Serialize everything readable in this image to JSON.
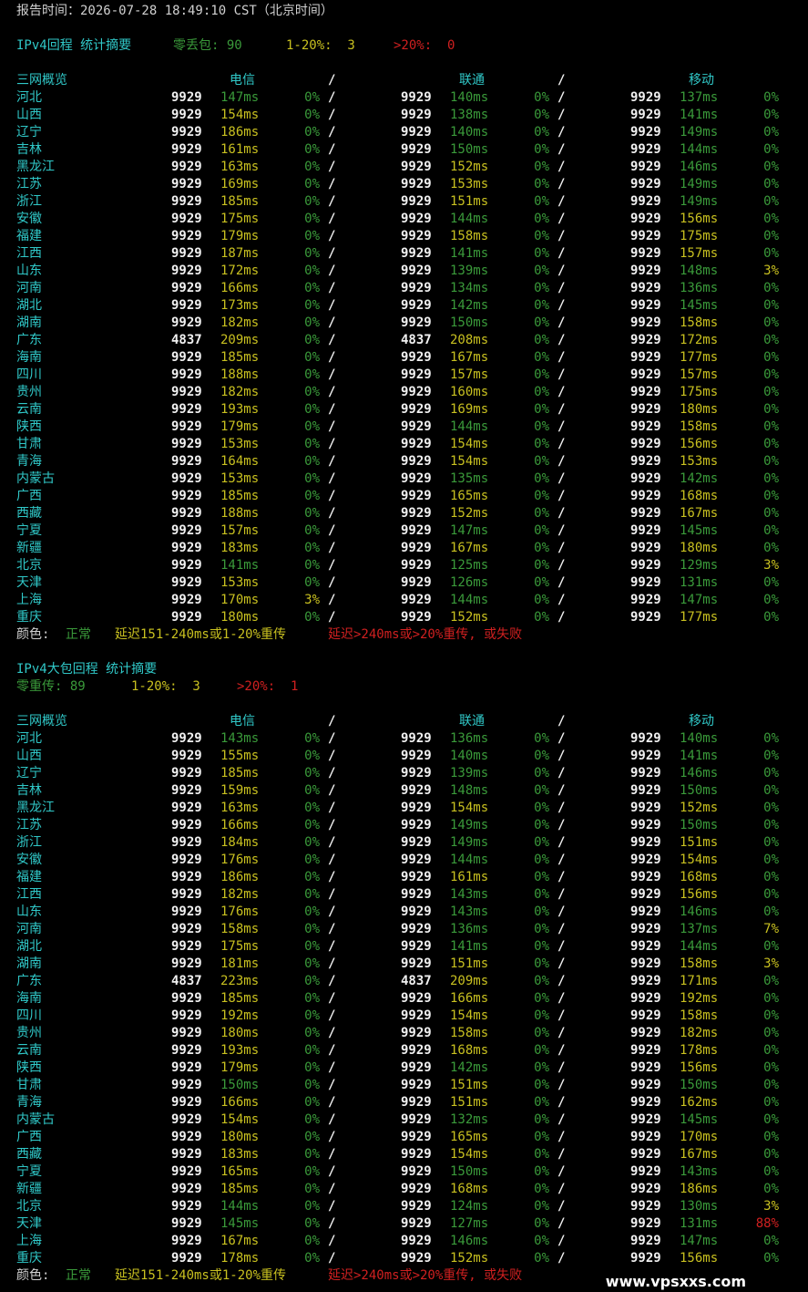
{
  "header": {
    "report_time": "报告时间：2026-07-28 18:49:10 CST（北京时间）"
  },
  "colors": {
    "cyan": "#30c8c8",
    "green": "#3a9a3a",
    "yellow": "#c8c020",
    "red": "#d02020",
    "white": "#d0d0d0"
  },
  "sections": [
    {
      "id": "ipv4",
      "summary": [
        {
          "t": "IPv4回程 统计摘要",
          "c": "cyan"
        },
        {
          "t": "零丢包: 90",
          "c": "green"
        },
        {
          "t": "1-20%:  3",
          "c": "yellow"
        },
        {
          "t": ">20%:  0",
          "c": "red"
        }
      ],
      "summary_wrap": false,
      "columns": {
        "region": "三网概览",
        "dx": "电信",
        "lt": "联通",
        "yd": "移动",
        "sep": "/"
      },
      "rows": [
        [
          "河北",
          "9929",
          "147ms",
          "0%",
          "9929",
          "140ms",
          "0%",
          "9929",
          "137ms",
          "0%"
        ],
        [
          "山西",
          "9929",
          "154ms",
          "0%",
          "9929",
          "138ms",
          "0%",
          "9929",
          "141ms",
          "0%"
        ],
        [
          "辽宁",
          "9929",
          "186ms",
          "0%",
          "9929",
          "140ms",
          "0%",
          "9929",
          "149ms",
          "0%"
        ],
        [
          "吉林",
          "9929",
          "161ms",
          "0%",
          "9929",
          "150ms",
          "0%",
          "9929",
          "144ms",
          "0%"
        ],
        [
          "黑龙江",
          "9929",
          "163ms",
          "0%",
          "9929",
          "152ms",
          "0%",
          "9929",
          "146ms",
          "0%"
        ],
        [
          "江苏",
          "9929",
          "169ms",
          "0%",
          "9929",
          "153ms",
          "0%",
          "9929",
          "149ms",
          "0%"
        ],
        [
          "浙江",
          "9929",
          "185ms",
          "0%",
          "9929",
          "151ms",
          "0%",
          "9929",
          "149ms",
          "0%"
        ],
        [
          "安徽",
          "9929",
          "175ms",
          "0%",
          "9929",
          "144ms",
          "0%",
          "9929",
          "156ms",
          "0%"
        ],
        [
          "福建",
          "9929",
          "179ms",
          "0%",
          "9929",
          "158ms",
          "0%",
          "9929",
          "175ms",
          "0%"
        ],
        [
          "江西",
          "9929",
          "187ms",
          "0%",
          "9929",
          "141ms",
          "0%",
          "9929",
          "157ms",
          "0%"
        ],
        [
          "山东",
          "9929",
          "172ms",
          "0%",
          "9929",
          "139ms",
          "0%",
          "9929",
          "148ms",
          "3%"
        ],
        [
          "河南",
          "9929",
          "166ms",
          "0%",
          "9929",
          "134ms",
          "0%",
          "9929",
          "136ms",
          "0%"
        ],
        [
          "湖北",
          "9929",
          "173ms",
          "0%",
          "9929",
          "142ms",
          "0%",
          "9929",
          "145ms",
          "0%"
        ],
        [
          "湖南",
          "9929",
          "182ms",
          "0%",
          "9929",
          "150ms",
          "0%",
          "9929",
          "158ms",
          "0%"
        ],
        [
          "广东",
          "4837",
          "209ms",
          "0%",
          "4837",
          "208ms",
          "0%",
          "9929",
          "172ms",
          "0%"
        ],
        [
          "海南",
          "9929",
          "185ms",
          "0%",
          "9929",
          "167ms",
          "0%",
          "9929",
          "177ms",
          "0%"
        ],
        [
          "四川",
          "9929",
          "188ms",
          "0%",
          "9929",
          "157ms",
          "0%",
          "9929",
          "157ms",
          "0%"
        ],
        [
          "贵州",
          "9929",
          "182ms",
          "0%",
          "9929",
          "160ms",
          "0%",
          "9929",
          "175ms",
          "0%"
        ],
        [
          "云南",
          "9929",
          "193ms",
          "0%",
          "9929",
          "169ms",
          "0%",
          "9929",
          "180ms",
          "0%"
        ],
        [
          "陕西",
          "9929",
          "179ms",
          "0%",
          "9929",
          "144ms",
          "0%",
          "9929",
          "158ms",
          "0%"
        ],
        [
          "甘肃",
          "9929",
          "153ms",
          "0%",
          "9929",
          "154ms",
          "0%",
          "9929",
          "156ms",
          "0%"
        ],
        [
          "青海",
          "9929",
          "164ms",
          "0%",
          "9929",
          "154ms",
          "0%",
          "9929",
          "153ms",
          "0%"
        ],
        [
          "内蒙古",
          "9929",
          "153ms",
          "0%",
          "9929",
          "135ms",
          "0%",
          "9929",
          "142ms",
          "0%"
        ],
        [
          "广西",
          "9929",
          "185ms",
          "0%",
          "9929",
          "165ms",
          "0%",
          "9929",
          "168ms",
          "0%"
        ],
        [
          "西藏",
          "9929",
          "188ms",
          "0%",
          "9929",
          "152ms",
          "0%",
          "9929",
          "167ms",
          "0%"
        ],
        [
          "宁夏",
          "9929",
          "157ms",
          "0%",
          "9929",
          "147ms",
          "0%",
          "9929",
          "145ms",
          "0%"
        ],
        [
          "新疆",
          "9929",
          "183ms",
          "0%",
          "9929",
          "167ms",
          "0%",
          "9929",
          "180ms",
          "0%"
        ],
        [
          "北京",
          "9929",
          "141ms",
          "0%",
          "9929",
          "125ms",
          "0%",
          "9929",
          "129ms",
          "3%"
        ],
        [
          "天津",
          "9929",
          "153ms",
          "0%",
          "9929",
          "126ms",
          "0%",
          "9929",
          "131ms",
          "0%"
        ],
        [
          "上海",
          "9929",
          "170ms",
          "3%",
          "9929",
          "144ms",
          "0%",
          "9929",
          "147ms",
          "0%"
        ],
        [
          "重庆",
          "9929",
          "180ms",
          "0%",
          "9929",
          "152ms",
          "0%",
          "9929",
          "177ms",
          "0%"
        ]
      ],
      "legend": [
        {
          "t": "颜色:",
          "c": "white"
        },
        {
          "t": "正常",
          "c": "green"
        },
        {
          "t": "延迟151-240ms或1-20%重传",
          "c": "yellow"
        },
        {
          "t": "延迟>240ms或>20%重传, 或失败",
          "c": "red"
        }
      ]
    },
    {
      "id": "ipv4-large",
      "summary": [
        {
          "t": "IPv4大包回程 统计摘要",
          "c": "cyan"
        },
        {
          "t": "零重传: 89",
          "c": "green"
        },
        {
          "t": "1-20%:  3",
          "c": "yellow"
        },
        {
          "t": ">20%:  1",
          "c": "red"
        }
      ],
      "summary_wrap": true,
      "columns": {
        "region": "三网概览",
        "dx": "电信",
        "lt": "联通",
        "yd": "移动",
        "sep": "/"
      },
      "rows": [
        [
          "河北",
          "9929",
          "143ms",
          "0%",
          "9929",
          "136ms",
          "0%",
          "9929",
          "140ms",
          "0%"
        ],
        [
          "山西",
          "9929",
          "155ms",
          "0%",
          "9929",
          "140ms",
          "0%",
          "9929",
          "141ms",
          "0%"
        ],
        [
          "辽宁",
          "9929",
          "185ms",
          "0%",
          "9929",
          "139ms",
          "0%",
          "9929",
          "146ms",
          "0%"
        ],
        [
          "吉林",
          "9929",
          "159ms",
          "0%",
          "9929",
          "148ms",
          "0%",
          "9929",
          "150ms",
          "0%"
        ],
        [
          "黑龙江",
          "9929",
          "163ms",
          "0%",
          "9929",
          "154ms",
          "0%",
          "9929",
          "152ms",
          "0%"
        ],
        [
          "江苏",
          "9929",
          "166ms",
          "0%",
          "9929",
          "149ms",
          "0%",
          "9929",
          "150ms",
          "0%"
        ],
        [
          "浙江",
          "9929",
          "184ms",
          "0%",
          "9929",
          "149ms",
          "0%",
          "9929",
          "151ms",
          "0%"
        ],
        [
          "安徽",
          "9929",
          "176ms",
          "0%",
          "9929",
          "144ms",
          "0%",
          "9929",
          "154ms",
          "0%"
        ],
        [
          "福建",
          "9929",
          "186ms",
          "0%",
          "9929",
          "161ms",
          "0%",
          "9929",
          "168ms",
          "0%"
        ],
        [
          "江西",
          "9929",
          "182ms",
          "0%",
          "9929",
          "143ms",
          "0%",
          "9929",
          "156ms",
          "0%"
        ],
        [
          "山东",
          "9929",
          "176ms",
          "0%",
          "9929",
          "143ms",
          "0%",
          "9929",
          "146ms",
          "0%"
        ],
        [
          "河南",
          "9929",
          "158ms",
          "0%",
          "9929",
          "136ms",
          "0%",
          "9929",
          "137ms",
          "7%"
        ],
        [
          "湖北",
          "9929",
          "175ms",
          "0%",
          "9929",
          "141ms",
          "0%",
          "9929",
          "144ms",
          "0%"
        ],
        [
          "湖南",
          "9929",
          "181ms",
          "0%",
          "9929",
          "151ms",
          "0%",
          "9929",
          "158ms",
          "3%"
        ],
        [
          "广东",
          "4837",
          "223ms",
          "0%",
          "4837",
          "209ms",
          "0%",
          "9929",
          "171ms",
          "0%"
        ],
        [
          "海南",
          "9929",
          "185ms",
          "0%",
          "9929",
          "166ms",
          "0%",
          "9929",
          "192ms",
          "0%"
        ],
        [
          "四川",
          "9929",
          "192ms",
          "0%",
          "9929",
          "154ms",
          "0%",
          "9929",
          "158ms",
          "0%"
        ],
        [
          "贵州",
          "9929",
          "180ms",
          "0%",
          "9929",
          "158ms",
          "0%",
          "9929",
          "182ms",
          "0%"
        ],
        [
          "云南",
          "9929",
          "193ms",
          "0%",
          "9929",
          "168ms",
          "0%",
          "9929",
          "178ms",
          "0%"
        ],
        [
          "陕西",
          "9929",
          "179ms",
          "0%",
          "9929",
          "142ms",
          "0%",
          "9929",
          "156ms",
          "0%"
        ],
        [
          "甘肃",
          "9929",
          "150ms",
          "0%",
          "9929",
          "151ms",
          "0%",
          "9929",
          "150ms",
          "0%"
        ],
        [
          "青海",
          "9929",
          "166ms",
          "0%",
          "9929",
          "151ms",
          "0%",
          "9929",
          "162ms",
          "0%"
        ],
        [
          "内蒙古",
          "9929",
          "154ms",
          "0%",
          "9929",
          "132ms",
          "0%",
          "9929",
          "145ms",
          "0%"
        ],
        [
          "广西",
          "9929",
          "180ms",
          "0%",
          "9929",
          "165ms",
          "0%",
          "9929",
          "170ms",
          "0%"
        ],
        [
          "西藏",
          "9929",
          "183ms",
          "0%",
          "9929",
          "154ms",
          "0%",
          "9929",
          "167ms",
          "0%"
        ],
        [
          "宁夏",
          "9929",
          "165ms",
          "0%",
          "9929",
          "150ms",
          "0%",
          "9929",
          "143ms",
          "0%"
        ],
        [
          "新疆",
          "9929",
          "185ms",
          "0%",
          "9929",
          "168ms",
          "0%",
          "9929",
          "186ms",
          "0%"
        ],
        [
          "北京",
          "9929",
          "144ms",
          "0%",
          "9929",
          "124ms",
          "0%",
          "9929",
          "130ms",
          "3%"
        ],
        [
          "天津",
          "9929",
          "145ms",
          "0%",
          "9929",
          "127ms",
          "0%",
          "9929",
          "131ms",
          "88%"
        ],
        [
          "上海",
          "9929",
          "167ms",
          "0%",
          "9929",
          "146ms",
          "0%",
          "9929",
          "147ms",
          "0%"
        ],
        [
          "重庆",
          "9929",
          "178ms",
          "0%",
          "9929",
          "152ms",
          "0%",
          "9929",
          "156ms",
          "0%"
        ]
      ],
      "legend": [
        {
          "t": "颜色:",
          "c": "white"
        },
        {
          "t": "正常",
          "c": "green"
        },
        {
          "t": "延迟151-240ms或1-20%重传",
          "c": "yellow"
        },
        {
          "t": "延迟>240ms或>20%重传, 或失败",
          "c": "red"
        }
      ]
    }
  ],
  "watermark": "www.vpsxxs.com"
}
